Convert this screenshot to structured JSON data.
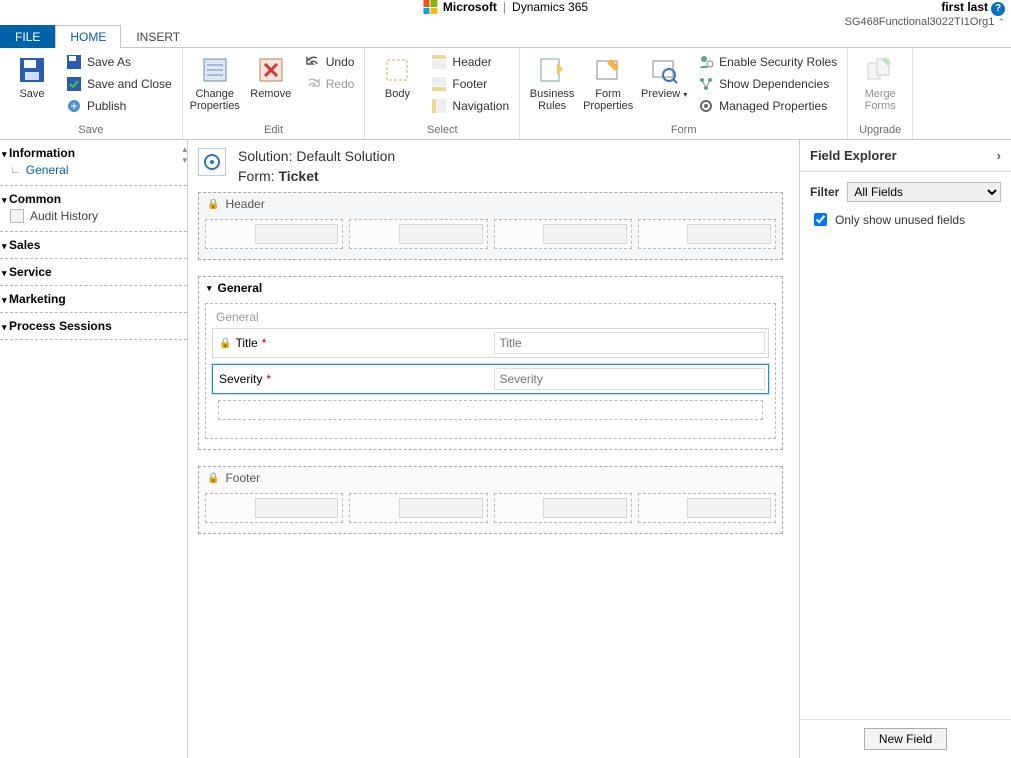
{
  "brand": {
    "company": "Microsoft",
    "separator": "|",
    "product": "Dynamics 365"
  },
  "user": {
    "name": "first last",
    "org": "SG468Functional3022TI1Org1"
  },
  "tabs": {
    "file": "FILE",
    "home": "HOME",
    "insert": "INSERT"
  },
  "ribbon": {
    "save": {
      "save": "Save",
      "saveAs": "Save As",
      "saveClose": "Save and Close",
      "publish": "Publish",
      "group": "Save"
    },
    "edit": {
      "changeProps": "Change Properties",
      "remove": "Remove",
      "undo": "Undo",
      "redo": "Redo",
      "group": "Edit"
    },
    "select": {
      "body": "Body",
      "header": "Header",
      "footer": "Footer",
      "nav": "Navigation",
      "group": "Select"
    },
    "form": {
      "rules": "Business Rules",
      "props": "Form Properties",
      "preview": "Preview",
      "secRoles": "Enable Security Roles",
      "deps": "Show Dependencies",
      "managed": "Managed Properties",
      "group": "Form"
    },
    "upgrade": {
      "merge": "Merge Forms",
      "group": "Upgrade"
    }
  },
  "leftnav": {
    "information": "Information",
    "general": "General",
    "common": "Common",
    "audit": "Audit History",
    "sales": "Sales",
    "service": "Service",
    "marketing": "Marketing",
    "process": "Process Sessions"
  },
  "canvas": {
    "solutionPrefix": "Solution: ",
    "solution": "Default Solution",
    "formPrefix": "Form: ",
    "formName": "Ticket",
    "headerLabel": "Header",
    "footerLabel": "Footer",
    "generalSection": "General",
    "generalTab": "General",
    "titleLabel": "Title",
    "titlePlaceholder": "Title",
    "severityLabel": "Severity",
    "severityPlaceholder": "Severity"
  },
  "rightpane": {
    "title": "Field Explorer",
    "filterLabel": "Filter",
    "filterValue": "All Fields",
    "unusedOnly": "Only show unused fields",
    "newField": "New Field"
  }
}
